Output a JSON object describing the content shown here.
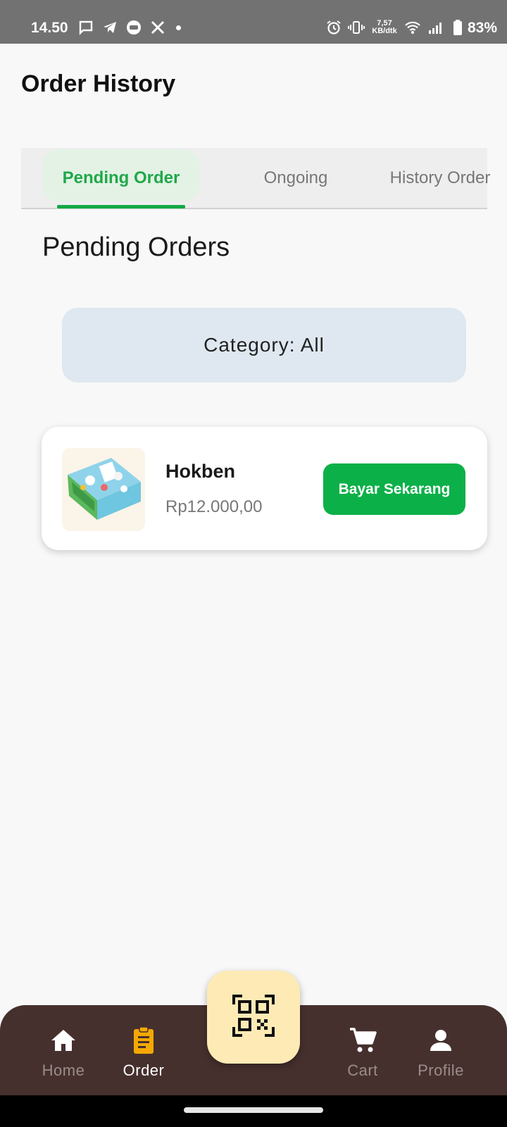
{
  "status_bar": {
    "time": "14.50",
    "net_speed_value": "7,57",
    "net_speed_unit": "KB/dtk",
    "battery": "83%",
    "left_icons": [
      "message-icon",
      "telegram-icon",
      "app-icon",
      "x-icon",
      "dot-icon"
    ],
    "right_icons": [
      "alarm-icon",
      "vibrate-icon",
      "wifi-icon",
      "signal-icon",
      "battery-icon"
    ]
  },
  "header": {
    "title": "Order History"
  },
  "tabs": [
    {
      "label": "Pending Order",
      "active": true
    },
    {
      "label": "Ongoing",
      "active": false
    },
    {
      "label": "History Order",
      "active": false
    }
  ],
  "section": {
    "title": "Pending Orders"
  },
  "filter": {
    "category_label": "Category: All"
  },
  "orders": [
    {
      "name": "Hokben",
      "price": "Rp12.000,00",
      "action_label": "Bayar Sekarang",
      "image_icon": "food-box-icon"
    }
  ],
  "bottom_nav": {
    "items": [
      {
        "label": "Home",
        "icon": "home-icon",
        "active": false
      },
      {
        "label": "Order",
        "icon": "clipboard-icon",
        "active": true
      },
      {
        "label": "Cart",
        "icon": "cart-icon",
        "active": false
      },
      {
        "label": "Profile",
        "icon": "person-icon",
        "active": false
      }
    ],
    "fab_icon": "qr-scan-icon"
  },
  "colors": {
    "accent_green": "#0bb048",
    "tab_active_text": "#1fa84a",
    "nav_background": "#46302e",
    "fab_background": "#fdeab5",
    "order_icon_active": "#f5a800",
    "category_background": "#dfe8f0"
  }
}
